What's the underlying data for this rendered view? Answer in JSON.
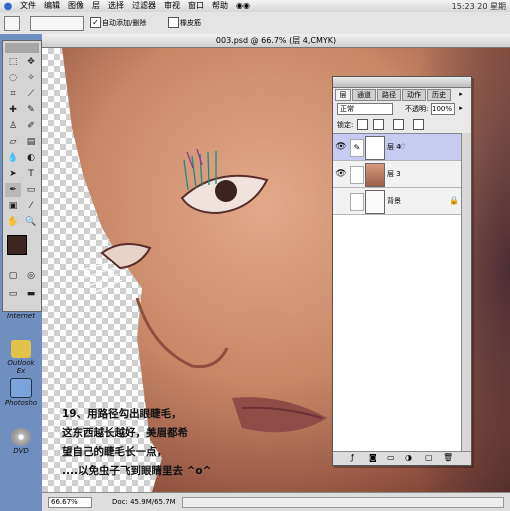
{
  "menubar": {
    "items": [
      "文件",
      "编辑",
      "图像",
      "层",
      "选择",
      "过滤器",
      "审视",
      "窗口",
      "帮助"
    ],
    "clock": "15:23 20 星期"
  },
  "optionsbar": {
    "auto_add_delete": "自动添加/删除",
    "rubber_band": "橡皮筋"
  },
  "document": {
    "title": "003.psd @ 66.7% (层 4,CMYK)",
    "zoom": "66.67%",
    "doc_size": "Doc: 45.9M/65.7M"
  },
  "layers_palette": {
    "tabs": [
      "层",
      "通道",
      "路径",
      "动作",
      "历史"
    ],
    "blend_mode": "正常",
    "opacity_label": "不透明:",
    "opacity_value": "100%",
    "lock_label": "锁定:",
    "layers": [
      {
        "name": "层 4",
        "visible": true,
        "selected": true
      },
      {
        "name": "层 3",
        "visible": true,
        "selected": false
      },
      {
        "name": "背景",
        "visible": false,
        "selected": false,
        "locked": true
      }
    ]
  },
  "desktop": {
    "icons": [
      "Internet",
      "Outlook Ex",
      "Photosho",
      "DVD"
    ]
  },
  "caption": {
    "lines": [
      "19、用路径勾出眼睫毛，",
      "这东西越长越好，美眉都希",
      "望自己的睫毛长一点，",
      "....以免虫子飞到眼睛里去 ^o^"
    ]
  },
  "colors": {
    "desktop": "#6e8fc0",
    "skin": "#c88766",
    "layer_selected": "#c7cbf2"
  }
}
